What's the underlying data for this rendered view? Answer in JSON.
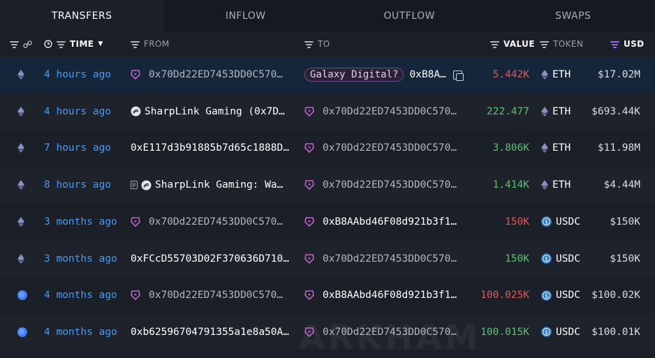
{
  "tabs": [
    {
      "label": "TRANSFERS"
    },
    {
      "label": "INFLOW"
    },
    {
      "label": "OUTFLOW"
    },
    {
      "label": "SWAPS"
    }
  ],
  "columns": {
    "time": "TIME",
    "from": "FROM",
    "to": "TO",
    "value": "VALUE",
    "token": "TOKEN",
    "usd": "USD"
  },
  "rows": [
    {
      "chain": "eth",
      "time": "4 hours ago",
      "from_icon": "arkham-entity-icon",
      "from": "0x70Dd22ED7453DD0C570…",
      "from_dim": true,
      "to_icon": "",
      "to_tag": "Galaxy Digital?",
      "to": "0xB8A…",
      "to_dim": false,
      "value": "5.442K",
      "value_dir": "neg",
      "token_icon": "eth-icon",
      "token": "ETH",
      "usd": "$17.02M",
      "selected": true
    },
    {
      "chain": "eth",
      "time": "4 hours ago",
      "from_icon": "sharplink-icon",
      "from": "SharpLink Gaming (0x7D…",
      "from_dim": false,
      "to_icon": "arkham-entity-icon",
      "to_tag": "",
      "to": "0x70Dd22ED7453DD0C570…",
      "to_dim": true,
      "value": "222.477",
      "value_dir": "pos",
      "token_icon": "eth-icon",
      "token": "ETH",
      "usd": "$693.44K"
    },
    {
      "chain": "eth",
      "time": "7 hours ago",
      "from_icon": "",
      "from": "0xE117d3b91885b7d65c1888D…",
      "from_dim": false,
      "to_icon": "arkham-entity-icon",
      "to_tag": "",
      "to": "0x70Dd22ED7453DD0C570…",
      "to_dim": true,
      "value": "3.806K",
      "value_dir": "pos",
      "token_icon": "eth-icon",
      "token": "ETH",
      "usd": "$11.98M"
    },
    {
      "chain": "eth",
      "time": "8 hours ago",
      "from_icon": "contract-sharplink-icon",
      "from": "SharpLink Gaming: Wa…",
      "from_dim": false,
      "to_icon": "arkham-entity-icon",
      "to_tag": "",
      "to": "0x70Dd22ED7453DD0C570…",
      "to_dim": true,
      "value": "1.414K",
      "value_dir": "pos",
      "token_icon": "eth-icon",
      "token": "ETH",
      "usd": "$4.44M"
    },
    {
      "chain": "eth",
      "time": "3 months ago",
      "from_icon": "arkham-entity-icon",
      "from": "0x70Dd22ED7453DD0C570…",
      "from_dim": true,
      "to_icon": "arkham-entity-icon",
      "to_tag": "",
      "to": "0xB8AAbd46F08d921b3f1…",
      "to_dim": false,
      "value": "150K",
      "value_dir": "neg",
      "token_icon": "usdc-icon",
      "token": "USDC",
      "usd": "$150K"
    },
    {
      "chain": "eth",
      "time": "3 months ago",
      "from_icon": "",
      "from": "0xFCcD55703D02F370636D710…",
      "from_dim": false,
      "to_icon": "arkham-entity-icon",
      "to_tag": "",
      "to": "0x70Dd22ED7453DD0C570…",
      "to_dim": true,
      "value": "150K",
      "value_dir": "pos",
      "token_icon": "usdc-icon",
      "token": "USDC",
      "usd": "$150K"
    },
    {
      "chain": "base",
      "time": "4 months ago",
      "from_icon": "arkham-entity-icon",
      "from": "0x70Dd22ED7453DD0C570…",
      "from_dim": true,
      "to_icon": "arkham-entity-icon",
      "to_tag": "",
      "to": "0xB8AAbd46F08d921b3f1…",
      "to_dim": false,
      "value": "100.025K",
      "value_dir": "neg",
      "token_icon": "usdc-icon",
      "token": "USDC",
      "usd": "$100.02K"
    },
    {
      "chain": "base",
      "time": "4 months ago",
      "from_icon": "",
      "from": "0xb62596704791355a1e8a50A…",
      "from_dim": false,
      "to_icon": "arkham-entity-icon",
      "to_tag": "",
      "to": "0x70Dd22ED7453DD0C570…",
      "to_dim": true,
      "value": "100.015K",
      "value_dir": "pos",
      "token_icon": "usdc-icon",
      "token": "USDC",
      "usd": "$100.01K"
    }
  ],
  "watermark": "ARKHAM",
  "colors": {
    "time": "#4a9af1",
    "value_neg": "#e05a5a",
    "value_pos": "#5fbf72",
    "selected_row": "#16263a",
    "accent_purple": "#9b6bdc"
  }
}
